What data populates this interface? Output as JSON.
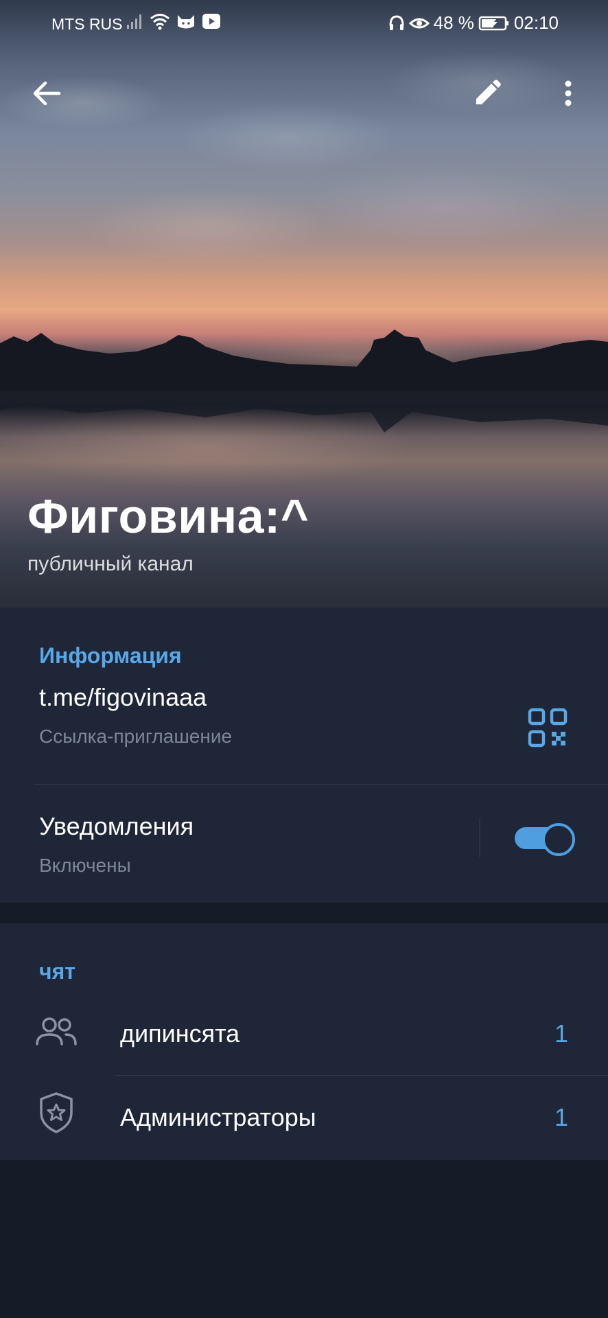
{
  "status_bar": {
    "carrier": "MTS RUS",
    "battery": "48 %",
    "time": "02:10"
  },
  "header": {
    "channel_name": "Фиговина:^",
    "channel_type": "публичный канал"
  },
  "info": {
    "section_title": "Информация",
    "link": "t.me/figovinaaa",
    "link_label": "Ссылка-приглашение",
    "notifications_label": "Уведомления",
    "notifications_status": "Включены",
    "notifications_enabled": true
  },
  "chat": {
    "section_title": "чят",
    "items": [
      {
        "label": "дипинсята",
        "count": "1",
        "icon": "people-icon"
      },
      {
        "label": "Администраторы",
        "count": "1",
        "icon": "admin-shield-icon"
      }
    ]
  },
  "colors": {
    "accent": "#5aa7e6",
    "background": "#151b27",
    "card": "#1e2637"
  }
}
